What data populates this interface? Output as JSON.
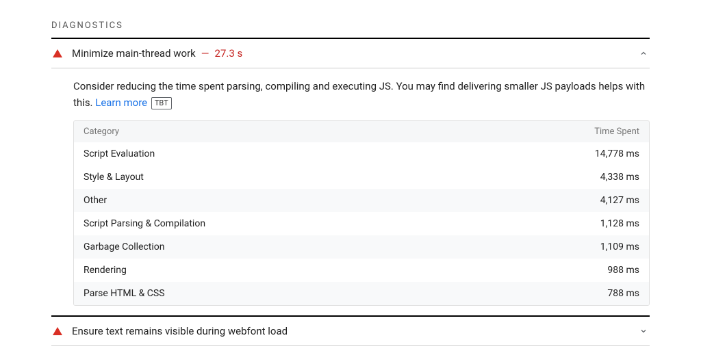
{
  "section_title": "DIAGNOSTICS",
  "audits": [
    {
      "title": "Minimize main-thread work",
      "dash": "—",
      "value": "27.3 s",
      "expanded": true,
      "description_pre": "Consider reducing the time spent parsing, compiling and executing JS. You may find delivering smaller JS payloads helps with this. ",
      "learn_more": "Learn more",
      "badge": "TBT",
      "table": {
        "header_left": "Category",
        "header_right": "Time Spent",
        "rows": [
          {
            "label": "Script Evaluation",
            "value": "14,778 ms"
          },
          {
            "label": "Style & Layout",
            "value": "4,338 ms"
          },
          {
            "label": "Other",
            "value": "4,127 ms"
          },
          {
            "label": "Script Parsing & Compilation",
            "value": "1,128 ms"
          },
          {
            "label": "Garbage Collection",
            "value": "1,109 ms"
          },
          {
            "label": "Rendering",
            "value": "988 ms"
          },
          {
            "label": "Parse HTML & CSS",
            "value": "788 ms"
          }
        ]
      }
    },
    {
      "title": "Ensure text remains visible during webfont load",
      "expanded": false
    }
  ]
}
